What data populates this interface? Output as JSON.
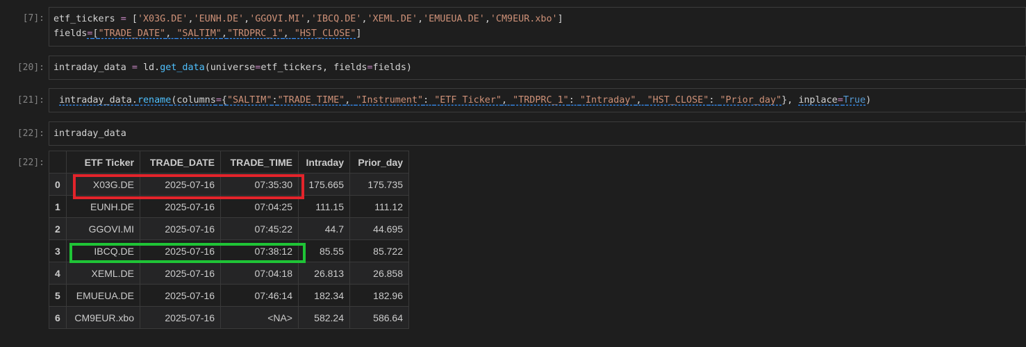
{
  "cells": [
    {
      "prompt": "[7]:",
      "lines": [
        [
          {
            "t": "etf_tickers",
            "c": "id"
          },
          {
            "t": " = ",
            "c": "op"
          },
          {
            "t": "[",
            "c": "id"
          },
          {
            "t": "'X03G.DE'",
            "c": "str"
          },
          {
            "t": ",",
            "c": "id"
          },
          {
            "t": "'EUNH.DE'",
            "c": "str"
          },
          {
            "t": ",",
            "c": "id"
          },
          {
            "t": "'GGOVI.MI'",
            "c": "str"
          },
          {
            "t": ",",
            "c": "id"
          },
          {
            "t": "'IBCQ.DE'",
            "c": "str"
          },
          {
            "t": ",",
            "c": "id"
          },
          {
            "t": "'XEML.DE'",
            "c": "str"
          },
          {
            "t": ",",
            "c": "id"
          },
          {
            "t": "'EMUEUA.DE'",
            "c": "str"
          },
          {
            "t": ",",
            "c": "id"
          },
          {
            "t": "'CM9EUR.xbo'",
            "c": "str"
          },
          {
            "t": "]",
            "c": "id"
          }
        ],
        [
          {
            "t": "fields",
            "c": "id"
          },
          {
            "t": "=",
            "c": "op",
            "u": true
          },
          {
            "t": "[",
            "c": "id",
            "u": true
          },
          {
            "t": "\"TRADE_DATE\"",
            "c": "str",
            "u": true
          },
          {
            "t": ", ",
            "c": "id",
            "u": true
          },
          {
            "t": "\"SALTIM\"",
            "c": "str",
            "u": true
          },
          {
            "t": ",",
            "c": "id",
            "u": true
          },
          {
            "t": "\"TRDPRC_1\"",
            "c": "str",
            "u": true
          },
          {
            "t": ", ",
            "c": "id",
            "u": true
          },
          {
            "t": "\"HST_CLOSE\"",
            "c": "str",
            "u": true
          },
          {
            "t": "]",
            "c": "id"
          }
        ]
      ]
    },
    {
      "prompt": "[20]:",
      "lines": [
        [
          {
            "t": "intraday_data",
            "c": "id"
          },
          {
            "t": " = ",
            "c": "op"
          },
          {
            "t": "ld.",
            "c": "id"
          },
          {
            "t": "get_data",
            "c": "fn"
          },
          {
            "t": "(universe",
            "c": "id"
          },
          {
            "t": "=",
            "c": "op"
          },
          {
            "t": "etf_tickers, fields",
            "c": "id"
          },
          {
            "t": "=",
            "c": "op"
          },
          {
            "t": "fields)",
            "c": "id"
          }
        ]
      ]
    },
    {
      "prompt": "[21]:",
      "lines": [
        [
          {
            "t": " ",
            "c": "id"
          },
          {
            "t": "intraday_data.",
            "c": "id",
            "u": true
          },
          {
            "t": "rename",
            "c": "fn",
            "u": true
          },
          {
            "t": "(columns",
            "c": "id",
            "u": true
          },
          {
            "t": "=",
            "c": "op",
            "u": true
          },
          {
            "t": "{",
            "c": "id",
            "u": true
          },
          {
            "t": "\"SALTIM\"",
            "c": "str",
            "u": true
          },
          {
            "t": ":",
            "c": "id",
            "u": true
          },
          {
            "t": "\"TRADE_TIME\"",
            "c": "str",
            "u": true
          },
          {
            "t": ", ",
            "c": "id",
            "u": true
          },
          {
            "t": "\"Instrument\"",
            "c": "str",
            "u": true
          },
          {
            "t": ": ",
            "c": "id",
            "u": true
          },
          {
            "t": "\"ETF Ticker\"",
            "c": "str",
            "u": true
          },
          {
            "t": ", ",
            "c": "id",
            "u": true
          },
          {
            "t": "\"TRDPRC_1\"",
            "c": "str",
            "u": true
          },
          {
            "t": ": ",
            "c": "id",
            "u": true
          },
          {
            "t": "\"Intraday\"",
            "c": "str",
            "u": true
          },
          {
            "t": ", ",
            "c": "id",
            "u": true
          },
          {
            "t": "\"HST_CLOSE\"",
            "c": "str",
            "u": true
          },
          {
            "t": ": ",
            "c": "id",
            "u": true
          },
          {
            "t": "\"Prior_day\"",
            "c": "str",
            "u": true
          },
          {
            "t": "}, ",
            "c": "id"
          },
          {
            "t": "inplace",
            "c": "id",
            "u": true
          },
          {
            "t": "=",
            "c": "op",
            "u": true
          },
          {
            "t": "True",
            "c": "bool",
            "u": true
          },
          {
            "t": ")",
            "c": "id"
          }
        ]
      ]
    },
    {
      "prompt": "[22]:",
      "lines": [
        [
          {
            "t": "intraday_data",
            "c": "id"
          }
        ]
      ]
    }
  ],
  "output": {
    "prompt": "[22]:",
    "columns": [
      "ETF Ticker",
      "TRADE_DATE",
      "TRADE_TIME",
      "Intraday",
      "Prior_day"
    ],
    "rows": [
      {
        "index": "0",
        "values": [
          "X03G.DE",
          "2025-07-16",
          "07:35:30",
          "175.665",
          "175.735"
        ]
      },
      {
        "index": "1",
        "values": [
          "EUNH.DE",
          "2025-07-16",
          "07:04:25",
          "111.15",
          "111.12"
        ]
      },
      {
        "index": "2",
        "values": [
          "GGOVI.MI",
          "2025-07-16",
          "07:45:22",
          "44.7",
          "44.695"
        ]
      },
      {
        "index": "3",
        "values": [
          "IBCQ.DE",
          "2025-07-16",
          "07:38:12",
          "85.55",
          "85.722"
        ]
      },
      {
        "index": "4",
        "values": [
          "XEML.DE",
          "2025-07-16",
          "07:04:18",
          "26.813",
          "26.858"
        ]
      },
      {
        "index": "5",
        "values": [
          "EMUEUA.DE",
          "2025-07-16",
          "07:46:14",
          "182.34",
          "182.96"
        ]
      },
      {
        "index": "6",
        "values": [
          "CM9EUR.xbo",
          "2025-07-16",
          "<NA>",
          "582.24",
          "586.64"
        ]
      }
    ]
  },
  "colors": {
    "string": "#ce9178",
    "operator": "#c586c0",
    "function": "#4fc1ff",
    "boolean": "#569cd6",
    "highlight_red": "#e3242b",
    "highlight_green": "#1fc436"
  }
}
